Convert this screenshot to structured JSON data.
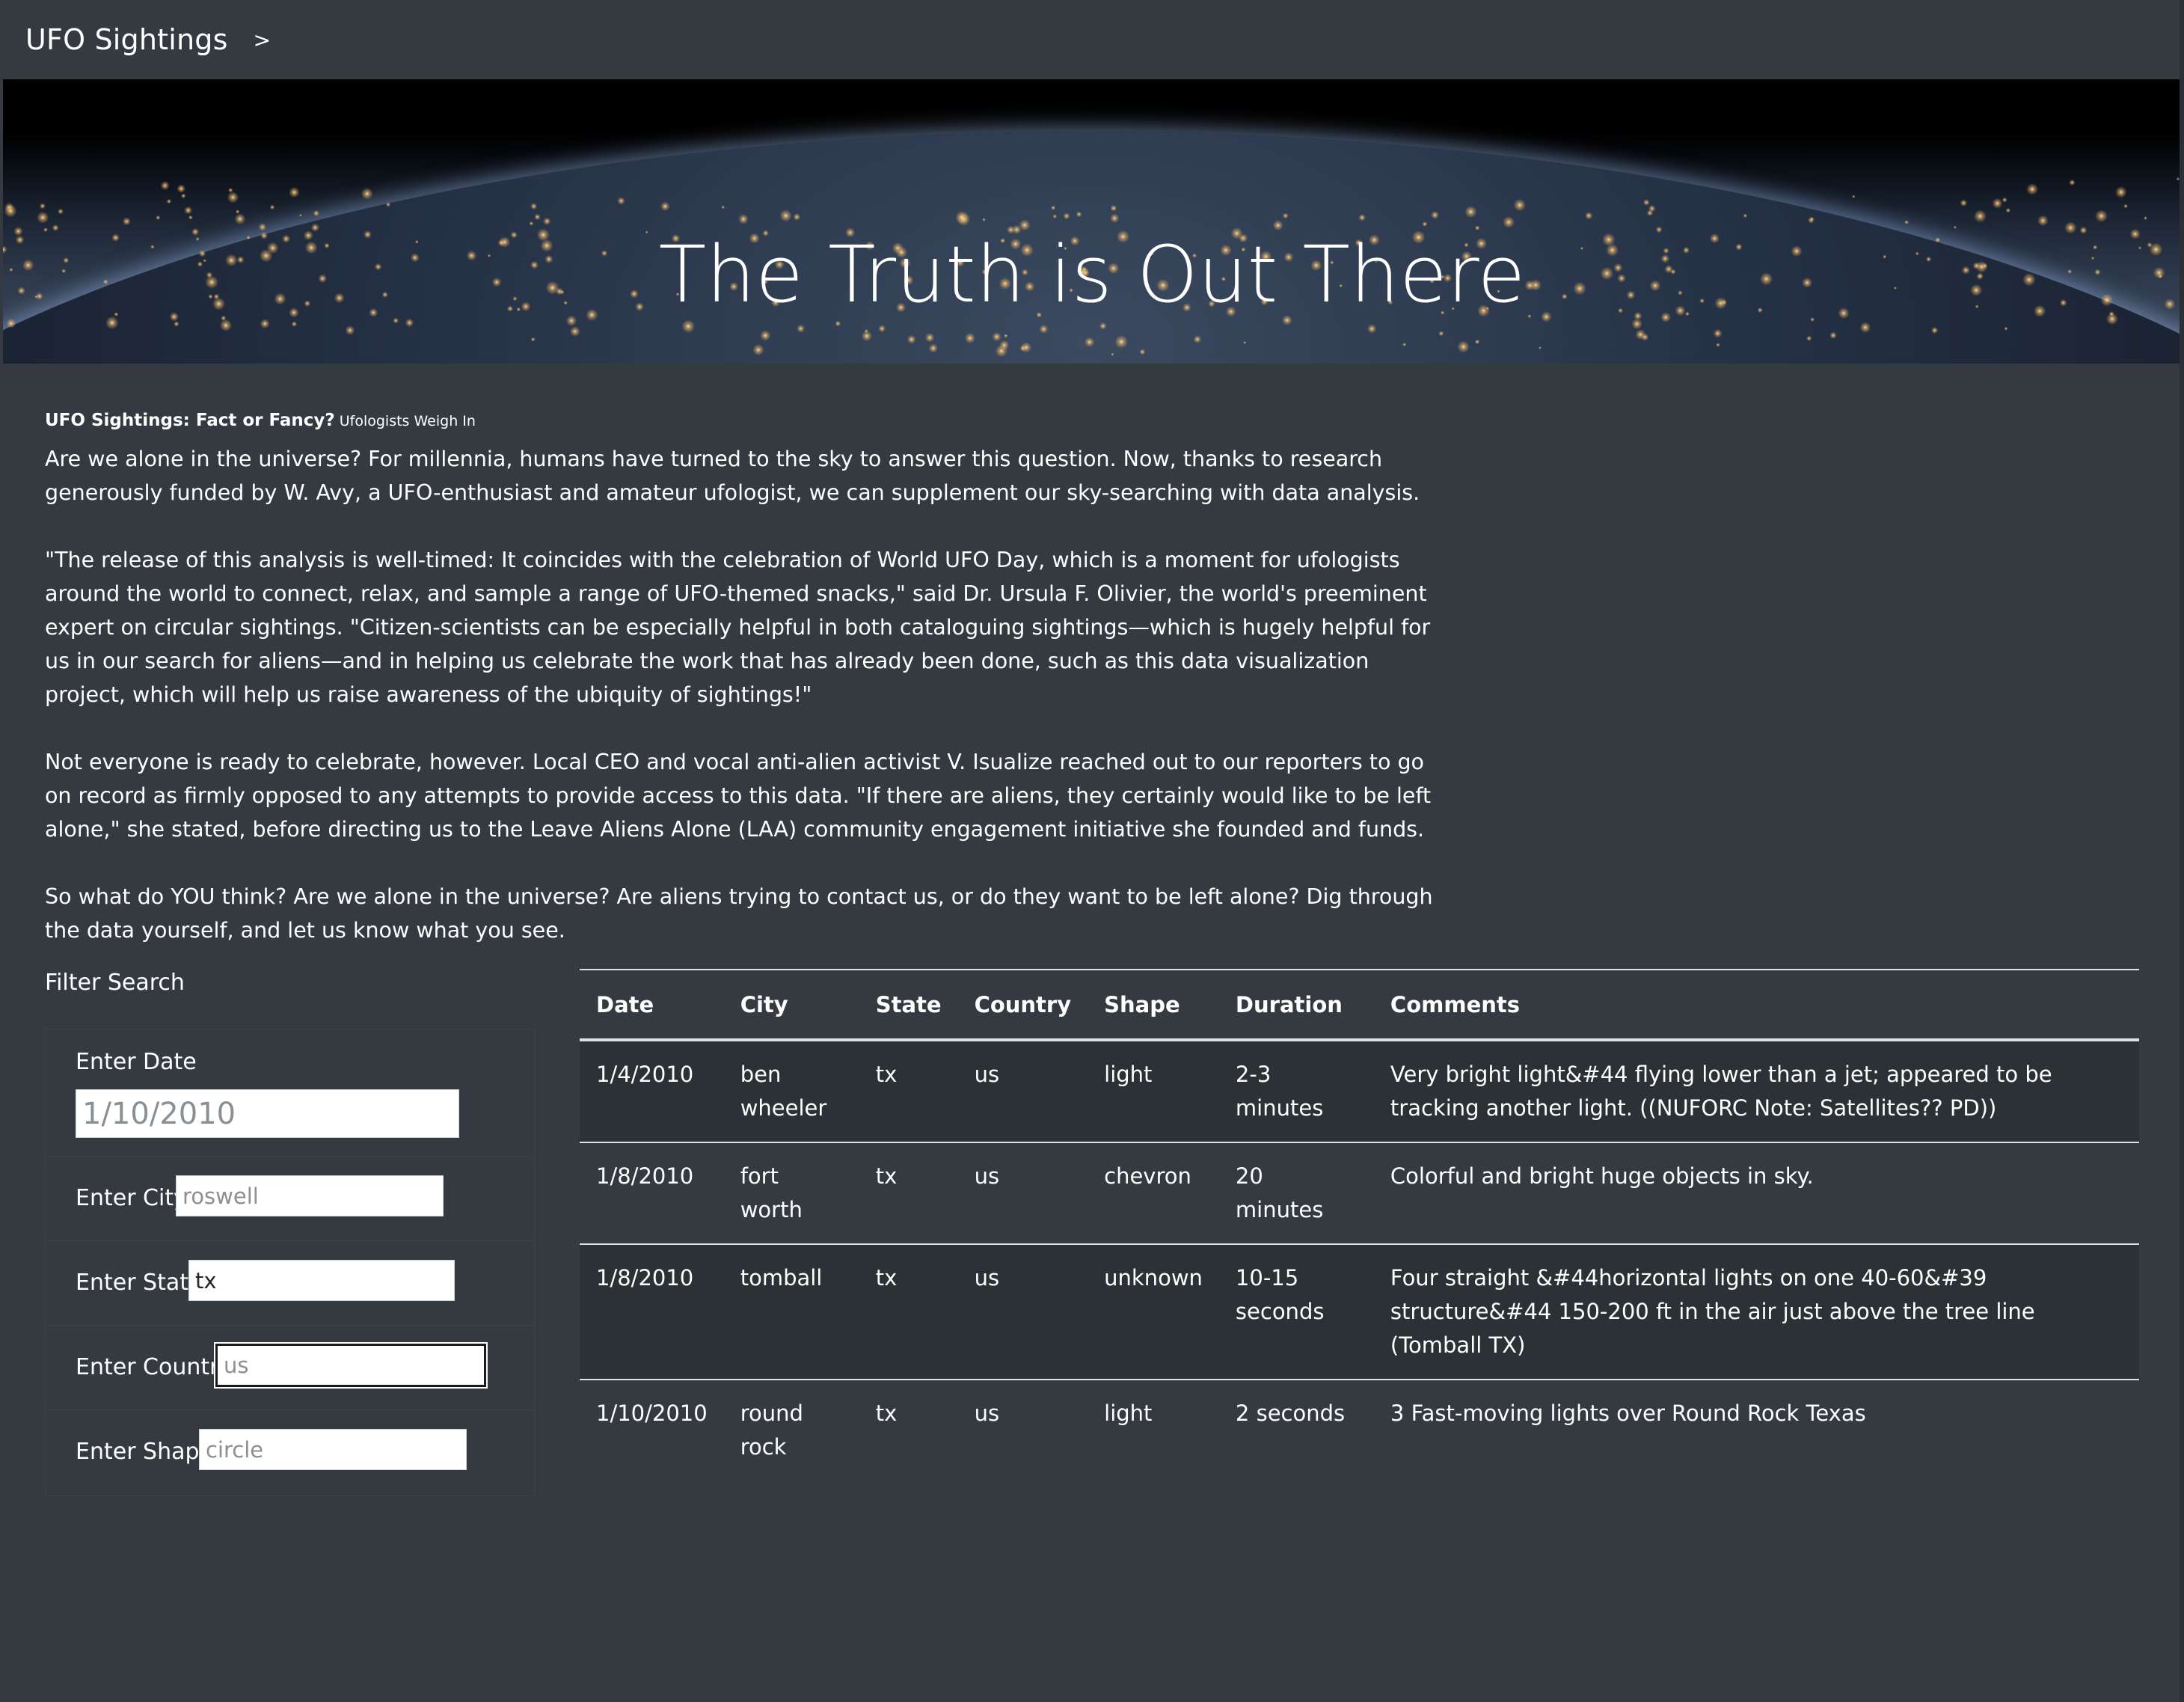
{
  "navbar": {
    "brand": "UFO Sightings",
    "toggler": ">"
  },
  "hero": {
    "title": "The Truth is Out There"
  },
  "article": {
    "heading": "UFO Sightings: Fact or Fancy?",
    "subheading": "Ufologists Weigh In",
    "paragraphs": [
      "Are we alone in the universe? For millennia, humans have turned to the sky to answer this question. Now, thanks to research generously funded by W. Avy, a UFO-enthusiast and amateur ufologist, we can supplement our sky-searching with data analysis.",
      "\"The release of this analysis is well-timed: It coincides with the celebration of World UFO Day, which is a moment for ufologists around the world to connect, relax, and sample a range of UFO-themed snacks,\" said Dr. Ursula F. Olivier, the world's preeminent expert on circular sightings. \"Citizen-scientists can be especially helpful in both cataloguing sightings—which is hugely helpful for us in our search for aliens—and in helping us celebrate the work that has already been done, such as this data visualization project, which will help us raise awareness of the ubiquity of sightings!\"",
      "Not everyone is ready to celebrate, however. Local CEO and vocal anti-alien activist V. Isualize reached out to our reporters to go on record as firmly opposed to any attempts to provide access to this data. \"If there are aliens, they certainly would like to be left alone,\" she stated, before directing us to the Leave Aliens Alone (LAA) community engagement initiative she founded and funds.",
      "So what do YOU think? Are we alone in the universe? Are aliens trying to contact us, or do they want to be left alone? Dig through the data yourself, and let us know what you see."
    ]
  },
  "filters": {
    "title": "Filter Search",
    "date": {
      "label": "Enter Date",
      "placeholder": "1/10/2010",
      "value": ""
    },
    "city": {
      "label": "Enter City",
      "placeholder": "roswell",
      "value": ""
    },
    "state": {
      "label": "Enter State",
      "placeholder": "",
      "value": "tx"
    },
    "country": {
      "label": "Enter Country",
      "placeholder": "us",
      "value": ""
    },
    "shape": {
      "label": "Enter Shape",
      "placeholder": "circle",
      "value": ""
    }
  },
  "table": {
    "headers": {
      "date": "Date",
      "city": "City",
      "state": "State",
      "country": "Country",
      "shape": "Shape",
      "duration": "Duration",
      "comments": "Comments"
    },
    "rows": [
      {
        "date": "1/4/2010",
        "city": "ben wheeler",
        "state": "tx",
        "country": "us",
        "shape": "light",
        "duration": "2-3 minutes",
        "comments": "Very bright light&#44 flying lower than a jet; appeared to be tracking another light. ((NUFORC Note: Satellites?? PD))"
      },
      {
        "date": "1/8/2010",
        "city": "fort worth",
        "state": "tx",
        "country": "us",
        "shape": "chevron",
        "duration": "20 minutes",
        "comments": "Colorful and bright huge objects in sky."
      },
      {
        "date": "1/8/2010",
        "city": "tomball",
        "state": "tx",
        "country": "us",
        "shape": "unknown",
        "duration": "10-15 seconds",
        "comments": "Four straight &#44horizontal lights on one 40-60&#39 structure&#44 150-200 ft in the air just above the tree line (Tomball TX)"
      },
      {
        "date": "1/10/2010",
        "city": "round rock",
        "state": "tx",
        "country": "us",
        "shape": "light",
        "duration": "2 seconds",
        "comments": "3 Fast-moving lights over Round Rock Texas"
      }
    ]
  }
}
